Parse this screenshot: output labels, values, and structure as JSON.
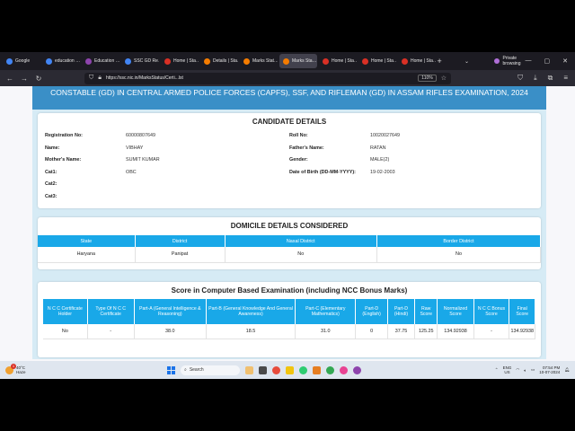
{
  "browser": {
    "tabs": [
      {
        "label": "Google",
        "active": false
      },
      {
        "label": "education …",
        "active": false
      },
      {
        "label": "Education …",
        "active": false
      },
      {
        "label": "SSC GD Re…",
        "active": false
      },
      {
        "label": "Home | Sta…",
        "active": false
      },
      {
        "label": "Details | Sta…",
        "active": false
      },
      {
        "label": "Marks Stat…",
        "active": false
      },
      {
        "label": "Marks Sta…",
        "active": true
      },
      {
        "label": "Home | Sta…",
        "active": false
      },
      {
        "label": "Home | Sta…",
        "active": false
      },
      {
        "label": "Home | Sta…",
        "active": false
      }
    ],
    "private_label": "Private browsing",
    "url": "https://ssc.nic.in/MarksStatus/Certi...lst",
    "zoom": "110%"
  },
  "page": {
    "header_title": "CONSTABLE (GD) IN CENTRAL ARMED POLICE FORCES (CAPFS), SSF, AND RIFLEMAN (GD) IN ASSAM RIFLES EXAMINATION, 2024",
    "candidate": {
      "title": "CANDIDATE DETAILS",
      "reg_label": "Registration No:",
      "reg_value": "60000807649",
      "roll_label": "Roll No:",
      "roll_value": "10020027649",
      "name_label": "Name:",
      "name_value": "VIBHAY",
      "father_label": "Father's Name:",
      "father_value": "RATAN",
      "mother_label": "Mother's Name:",
      "mother_value": "SUMIT KUMAR",
      "gender_label": "Gender:",
      "gender_value": "MALE(2)",
      "cat1_label": "Cat1:",
      "cat1_value": "OBC",
      "dob_label": "Date of Birth (DD-MM-YYYY):",
      "dob_value": "19-02-2003",
      "cat2_label": "Cat2:",
      "cat3_label": "Cat3:"
    },
    "domicile": {
      "title": "DOMICILE DETAILS CONSIDERED",
      "headers": [
        "State",
        "District",
        "Naxal District",
        "Border District"
      ],
      "row": [
        "Haryana",
        "Panipat",
        "No",
        "No"
      ]
    },
    "score": {
      "title": "Score in Computer Based Examination (including NCC Bonus Marks)",
      "headers": [
        "N C C Certificate Holder",
        "Type Of N C C Certificate",
        "Part-A (General Intelligence & Reasoning)",
        "Part-B (General Knowledge And General Awareness)",
        "Part-C (Elementary Mathematics)",
        "Part-D (English)",
        "Part-D (Hindi)",
        "Raw Score",
        "Normalized Score",
        "N C C Bonus Score",
        "Final Score"
      ],
      "row": [
        "No",
        "-",
        "38.0",
        "18.5",
        "31.0",
        "0",
        "37.75",
        "125.25",
        "134.92938",
        "-",
        "134.92938"
      ]
    }
  },
  "taskbar": {
    "temp": "40°C",
    "weather": "Haze",
    "badge": "1",
    "search_label": "Search",
    "lang_line1": "ENG",
    "lang_line2": "US",
    "time": "07:54 PM",
    "date": "10-07-2024"
  }
}
